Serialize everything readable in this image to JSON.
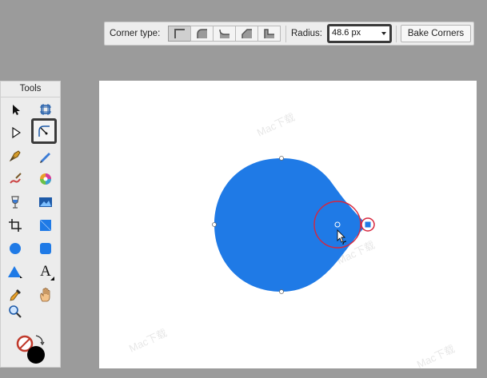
{
  "toolbar": {
    "corner_type_label": "Corner type:",
    "corner_types": [
      {
        "icon": "corner-none-icon",
        "active": true
      },
      {
        "icon": "corner-round-icon",
        "active": false
      },
      {
        "icon": "corner-inverted-round-icon",
        "active": false
      },
      {
        "icon": "corner-bevel-icon",
        "active": false
      },
      {
        "icon": "corner-inset-icon",
        "active": false
      }
    ],
    "radius_label": "Radius:",
    "radius_value": "48.6 px",
    "bake_label": "Bake Corners"
  },
  "tools_panel": {
    "title": "Tools",
    "tools": [
      {
        "icon": "move-tool-icon"
      },
      {
        "icon": "artboard-tool-icon"
      },
      {
        "icon": "node-tool-icon"
      },
      {
        "icon": "corner-tool-icon",
        "selected": true
      },
      {
        "icon": "pen-tool-icon"
      },
      {
        "icon": "pencil-tool-icon"
      },
      {
        "icon": "vector-brush-icon"
      },
      {
        "icon": "fill-tool-icon"
      },
      {
        "icon": "transparency-tool-icon"
      },
      {
        "icon": "place-image-icon"
      },
      {
        "icon": "crop-tool-icon"
      },
      {
        "icon": "rectangle-tool-icon"
      },
      {
        "icon": "ellipse-tool-icon"
      },
      {
        "icon": "rounded-rectangle-tool-icon"
      },
      {
        "icon": "triangle-tool-icon"
      },
      {
        "icon": "text-tool-icon"
      },
      {
        "icon": "color-picker-icon"
      },
      {
        "icon": "view-tool-icon"
      },
      {
        "icon": "zoom-tool-icon"
      }
    ],
    "text_glyph": "A",
    "colors": {
      "fill": "#000000",
      "stroke": "#ffffff"
    }
  },
  "canvas": {
    "shape_color": "#1f7ae6",
    "handle_color": "#d7263d",
    "background": "#ffffff"
  },
  "watermark_text": "Mac下载"
}
